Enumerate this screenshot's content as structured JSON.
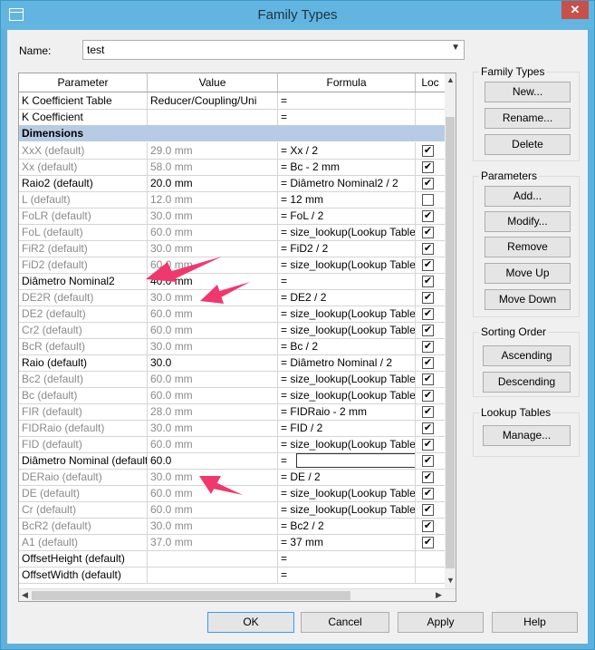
{
  "title": "Family Types",
  "name_label": "Name:",
  "name_value": "test",
  "columns": [
    "Parameter",
    "Value",
    "Formula",
    "Loc"
  ],
  "rows": [
    {
      "p": "K Coefficient Table",
      "v": "Reducer/Coupling/Uni",
      "f": "=",
      "lock": "",
      "grey": false
    },
    {
      "p": "K Coefficient",
      "v": "",
      "f": "=",
      "lock": "",
      "grey": false
    },
    {
      "group": "Dimensions"
    },
    {
      "p": "XxX (default)",
      "v": "29.0 mm",
      "f": "= Xx / 2",
      "lock": "✔",
      "grey": true
    },
    {
      "p": "Xx (default)",
      "v": "58.0 mm",
      "f": "= Bc - 2 mm",
      "lock": "✔",
      "grey": true
    },
    {
      "p": "Raio2 (default)",
      "v": "20.0 mm",
      "f": "= Diâmetro Nominal2 / 2",
      "lock": "✔",
      "grey": false
    },
    {
      "p": "L (default)",
      "v": "12.0 mm",
      "f": "= 12 mm",
      "lock": "",
      "grey": true
    },
    {
      "p": "FoLR (default)",
      "v": "30.0 mm",
      "f": "= FoL / 2",
      "lock": "✔",
      "grey": true
    },
    {
      "p": "FoL (default)",
      "v": "60.0 mm",
      "f": "= size_lookup(Lookup Table",
      "lock": "✔",
      "grey": true
    },
    {
      "p": "FiR2 (default)",
      "v": "30.0 mm",
      "f": "= FiD2 / 2",
      "lock": "✔",
      "grey": true
    },
    {
      "p": "FiD2 (default)",
      "v": "60.0 mm",
      "f": "= size_lookup(Lookup Table",
      "lock": "✔",
      "grey": true
    },
    {
      "p": "Diâmetro Nominal2",
      "v": "40.0 mm",
      "f": "=",
      "lock": "✔",
      "grey": false
    },
    {
      "p": "DE2R (default)",
      "v": "30.0 mm",
      "f": "= DE2 / 2",
      "lock": "✔",
      "grey": true
    },
    {
      "p": "DE2 (default)",
      "v": "60.0 mm",
      "f": "= size_lookup(Lookup Table",
      "lock": "✔",
      "grey": true
    },
    {
      "p": "Cr2 (default)",
      "v": "60.0 mm",
      "f": "= size_lookup(Lookup Table",
      "lock": "✔",
      "grey": true
    },
    {
      "p": "BcR (default)",
      "v": "30.0 mm",
      "f": "= Bc / 2",
      "lock": "✔",
      "grey": true
    },
    {
      "p": "Raio (default)",
      "v": "30.0",
      "f": "= Diâmetro Nominal / 2",
      "lock": "✔",
      "grey": false
    },
    {
      "p": "Bc2 (default)",
      "v": "60.0 mm",
      "f": "= size_lookup(Lookup Table",
      "lock": "✔",
      "grey": true
    },
    {
      "p": "Bc (default)",
      "v": "60.0 mm",
      "f": "= size_lookup(Lookup Table",
      "lock": "✔",
      "grey": true
    },
    {
      "p": "FIR (default)",
      "v": "28.0 mm",
      "f": "= FIDRaio - 2 mm",
      "lock": "✔",
      "grey": true
    },
    {
      "p": "FIDRaio (default)",
      "v": "30.0 mm",
      "f": "= FID / 2",
      "lock": "✔",
      "grey": true
    },
    {
      "p": "FID (default)",
      "v": "60.0 mm",
      "f": "= size_lookup(Lookup Table",
      "lock": "✔",
      "grey": true
    },
    {
      "p": "Diâmetro Nominal (default)",
      "v": "60.0",
      "f": "=",
      "lock": "✔",
      "grey": false,
      "editing": true
    },
    {
      "p": "DERaio (default)",
      "v": "30.0 mm",
      "f": "= DE / 2",
      "lock": "✔",
      "grey": true
    },
    {
      "p": "DE (default)",
      "v": "60.0 mm",
      "f": "= size_lookup(Lookup Table",
      "lock": "✔",
      "grey": true
    },
    {
      "p": "Cr (default)",
      "v": "60.0 mm",
      "f": "= size_lookup(Lookup Table",
      "lock": "✔",
      "grey": true
    },
    {
      "p": "BcR2 (default)",
      "v": "30.0 mm",
      "f": "= Bc2 / 2",
      "lock": "✔",
      "grey": true
    },
    {
      "p": "A1 (default)",
      "v": "37.0 mm",
      "f": "= 37 mm",
      "lock": "✔",
      "grey": true
    },
    {
      "p": "OffsetHeight (default)",
      "v": "",
      "f": "=",
      "lock": "",
      "grey": false
    },
    {
      "p": "OffsetWidth (default)",
      "v": "",
      "f": "=",
      "lock": "",
      "grey": false
    }
  ],
  "family_types": {
    "title": "Family Types",
    "new": "New...",
    "rename": "Rename...",
    "delete": "Delete"
  },
  "parameters": {
    "title": "Parameters",
    "add": "Add...",
    "modify": "Modify...",
    "remove": "Remove",
    "move_up": "Move Up",
    "move_down": "Move Down"
  },
  "sorting": {
    "title": "Sorting Order",
    "ascending": "Ascending",
    "descending": "Descending"
  },
  "lookup": {
    "title": "Lookup Tables",
    "manage": "Manage..."
  },
  "footer": {
    "ok": "OK",
    "cancel": "Cancel",
    "apply": "Apply",
    "help": "Help"
  },
  "colors": {
    "titlebar": "#62b5e0",
    "group_row": "#b7cce4",
    "arrow": "#f0386e"
  }
}
